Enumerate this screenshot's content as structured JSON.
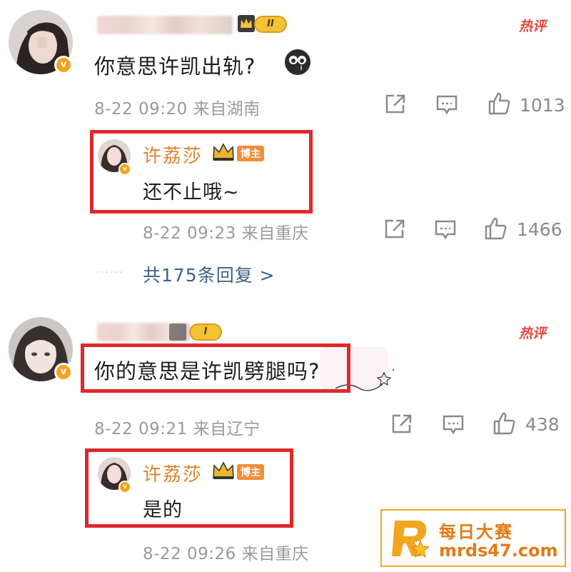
{
  "hot_label": "热评",
  "comments": [
    {
      "level": "II",
      "text": "你意思许凯出轨?",
      "time": "8-22 09:20",
      "source": "来自湖南",
      "likes": "1013",
      "reply": {
        "username": "许荔莎",
        "tag": "博主",
        "text": "还不止哦~",
        "time": "8-22 09:23",
        "source": "来自重庆",
        "likes": "1466"
      },
      "more_replies": "共175条回复 >"
    },
    {
      "level": "I",
      "text": "你的意思是许凯劈腿吗?",
      "time": "8-22 09:21",
      "source": "来自辽宁",
      "likes": "438",
      "reply": {
        "username": "许荔莎",
        "tag": "博主",
        "text": "是的",
        "time": "8-22 09:26",
        "source": "来自重庆"
      }
    }
  ],
  "watermark": {
    "title": "每日大赛",
    "url": "mrds47.com",
    "brand_color": "#e37a16"
  },
  "icons": [
    "share-icon",
    "comment-icon",
    "like-icon",
    "crown-icon",
    "verified-icon",
    "crying-emoji-icon"
  ]
}
